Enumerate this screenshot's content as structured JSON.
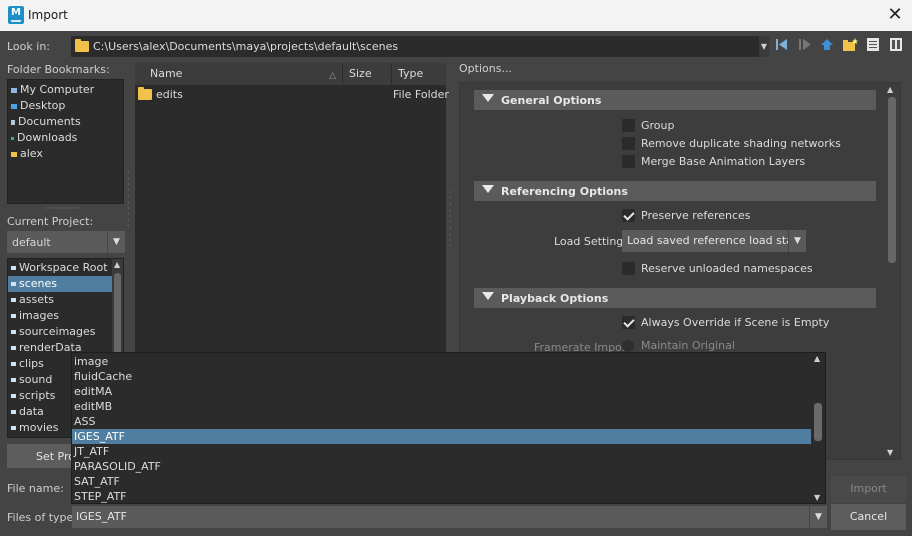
{
  "window": {
    "title": "Import",
    "app_icon_letter": "M"
  },
  "look_in": {
    "label": "Look in:",
    "path": "C:\\Users\\alex\\Documents\\maya\\projects\\default\\scenes"
  },
  "toolbar": {
    "buttons": [
      "back-icon",
      "forward-icon",
      "up-folder-icon",
      "new-folder-icon",
      "list-view-icon",
      "detail-view-icon"
    ]
  },
  "bookmarks": {
    "label": "Folder Bookmarks:",
    "items": [
      "My Computer",
      "Desktop",
      "Documents",
      "Downloads",
      "alex"
    ]
  },
  "current_project": {
    "label": "Current Project:",
    "value": "default"
  },
  "workspace": {
    "items": [
      "Workspace Root",
      "scenes",
      "assets",
      "images",
      "sourceimages",
      "renderData",
      "clips",
      "sound",
      "scripts",
      "data",
      "movies"
    ],
    "selected": "scenes"
  },
  "set_project": {
    "label": "Set Pro"
  },
  "file_list": {
    "columns": [
      "Name",
      "Size",
      "Type"
    ],
    "rows": [
      {
        "name": "edits",
        "size": "",
        "type": "File Folder"
      }
    ]
  },
  "options": {
    "label": "Options...",
    "general": {
      "title": "General Options",
      "group": "Group",
      "remove_dup": "Remove duplicate shading networks",
      "merge_base": "Merge Base Animation Layers"
    },
    "referencing": {
      "title": "Referencing Options",
      "preserve": "Preserve references",
      "load_settings_label": "Load Settings",
      "load_settings_value": "Load saved reference load state",
      "reserve": "Reserve unloaded namespaces"
    },
    "playback": {
      "title": "Playback Options",
      "always_override": "Always Override if Scene is Empty",
      "framerate_label": "Framerate Import",
      "maintain": "Maintain Original"
    }
  },
  "file_name": {
    "label": "File name:",
    "value": ""
  },
  "files_of_type": {
    "label": "Files of type:",
    "value": "IGES_ATF",
    "options": [
      "image",
      "fluidCache",
      "editMA",
      "editMB",
      "ASS",
      "IGES_ATF",
      "JT_ATF",
      "PARASOLID_ATF",
      "SAT_ATF",
      "STEP_ATF"
    ],
    "selected": "IGES_ATF"
  },
  "buttons": {
    "import": "Import",
    "cancel": "Cancel"
  }
}
